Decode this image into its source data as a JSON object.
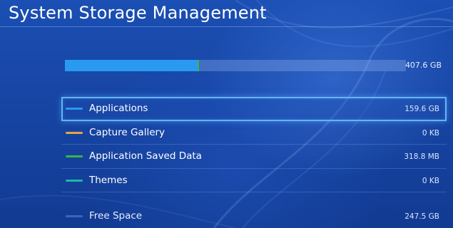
{
  "header": {
    "title": "System Storage Management"
  },
  "storage": {
    "total_label": "407.6 GB",
    "used_fraction": 0.39,
    "colors": {
      "applications": "#2a9af0",
      "saved_data": "#39b54a",
      "track": "#87aaeb"
    }
  },
  "items": [
    {
      "label": "Applications",
      "value": "159.6 GB",
      "color": "#2a9af0",
      "icon": "applications-swatch-icon",
      "selected": true
    },
    {
      "label": "Capture Gallery",
      "value": "0 KB",
      "color": "#e8a444",
      "icon": "capture-gallery-swatch-icon"
    },
    {
      "label": "Application Saved Data",
      "value": "318.8 MB",
      "color": "#39b54a",
      "icon": "saved-data-swatch-icon"
    },
    {
      "label": "Themes",
      "value": "0 KB",
      "color": "#1fb7a8",
      "icon": "themes-swatch-icon"
    },
    {
      "label": "Free Space",
      "value": "247.5 GB",
      "color": "#5f86d6",
      "icon": "free-space-swatch-icon"
    }
  ]
}
